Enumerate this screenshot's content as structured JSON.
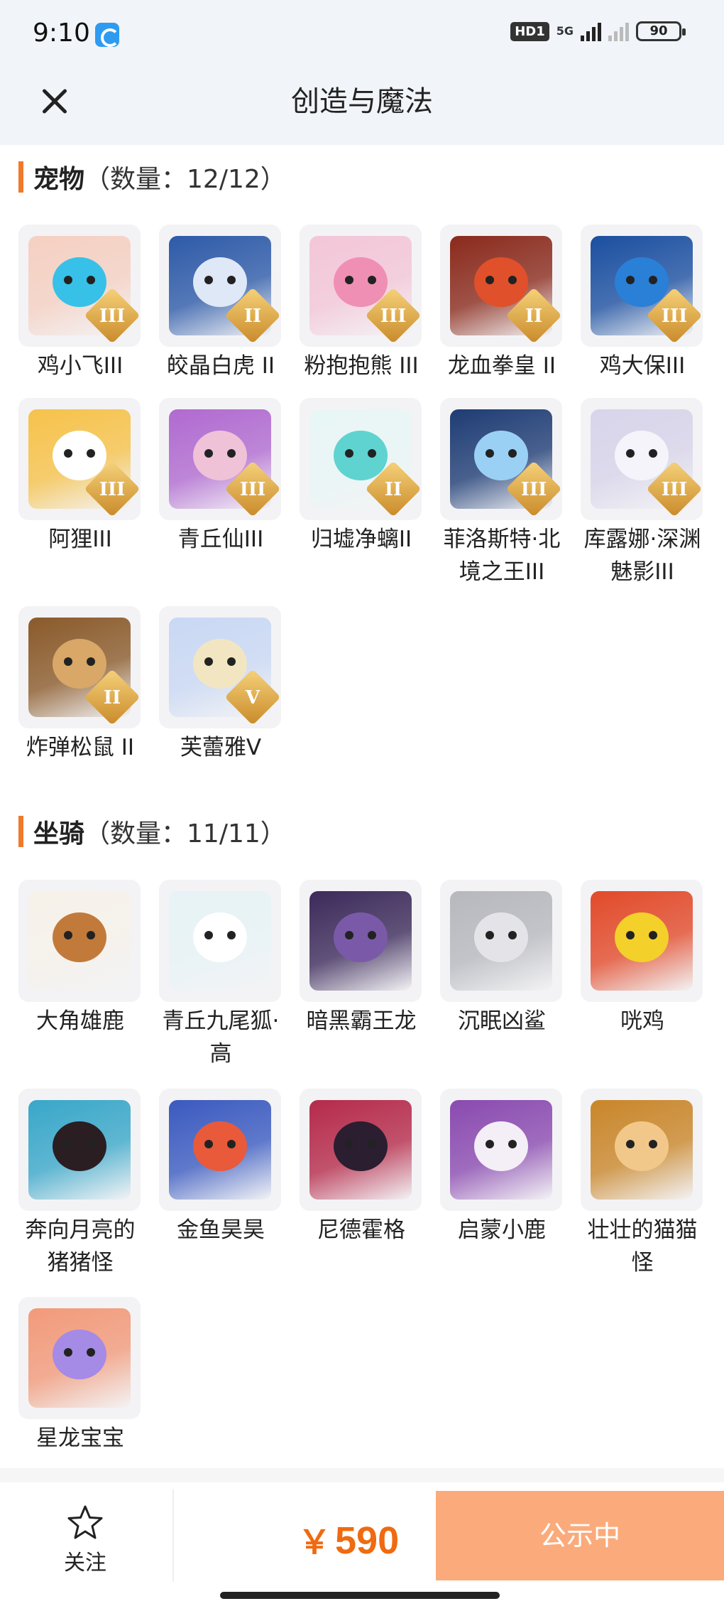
{
  "status_bar": {
    "time": "9:10",
    "network_badge": "HD1",
    "network_type": "5G",
    "battery": "90"
  },
  "header": {
    "title": "创造与魔法"
  },
  "pets": {
    "title": "宠物",
    "count": "（数量：12/12）",
    "items": [
      {
        "label": "鸡小飞III",
        "rank": "III",
        "color": "#37c1e8",
        "bg": "#f5d0c2"
      },
      {
        "label": "皎晶白虎 II",
        "rank": "II",
        "color": "#dfe8f7",
        "bg": "#2d5aa8"
      },
      {
        "label": "粉抱抱熊 III",
        "rank": "III",
        "color": "#f08fb4",
        "bg": "#f3c6d8"
      },
      {
        "label": "龙血拳皇 II",
        "rank": "II",
        "color": "#e0502a",
        "bg": "#8a2a1c"
      },
      {
        "label": "鸡大保III",
        "rank": "III",
        "color": "#2a7fd6",
        "bg": "#1b4fa0"
      },
      {
        "label": "阿狸III",
        "rank": "III",
        "color": "#ffffff",
        "bg": "#f6c24a"
      },
      {
        "label": "青丘仙III",
        "rank": "III",
        "color": "#f0c2d8",
        "bg": "#b06ad0"
      },
      {
        "label": "归墟净螭II",
        "rank": "II",
        "color": "#5fd3d0",
        "bg": "#e8f6f5"
      },
      {
        "label": "菲洛斯特·北境之王III",
        "rank": "III",
        "color": "#9ad0f4",
        "bg": "#1e3c74"
      },
      {
        "label": "库露娜·深渊魅影III",
        "rank": "III",
        "color": "#f4f4fa",
        "bg": "#d8d4ea"
      },
      {
        "label": "炸弹松鼠 II",
        "rank": "II",
        "color": "#d9a768",
        "bg": "#8a5a2a"
      },
      {
        "label": "芙蕾雅V",
        "rank": "V",
        "color": "#f2e6c2",
        "bg": "#c9d8f4"
      }
    ]
  },
  "mounts": {
    "title": "坐骑",
    "count": "（数量：11/11）",
    "items": [
      {
        "label": "大角雄鹿",
        "color": "#c27a3a",
        "bg": "#f6f2ea"
      },
      {
        "label": "青丘九尾狐·高",
        "color": "#ffffff",
        "bg": "#e7f3f6"
      },
      {
        "label": "暗黑霸王龙",
        "color": "#7a5aa8",
        "bg": "#3c2a5a"
      },
      {
        "label": "沉眠凶鲨",
        "color": "#e4e4e8",
        "bg": "#b7b8be"
      },
      {
        "label": "咣鸡",
        "color": "#f4d02a",
        "bg": "#e24a2a"
      },
      {
        "label": "奔向月亮的猪猪怪",
        "color": "#2a1e22",
        "bg": "#39a7c9"
      },
      {
        "label": "金鱼昊昊",
        "color": "#e85a3a",
        "bg": "#3a5ac0"
      },
      {
        "label": "尼德霍格",
        "color": "#2a1e30",
        "bg": "#b52a4a"
      },
      {
        "label": "启蒙小鹿",
        "color": "#f4eef6",
        "bg": "#8a4ab0"
      },
      {
        "label": "壮壮的猫猫怪",
        "color": "#f2c88a",
        "bg": "#c9862a"
      },
      {
        "label": "星龙宝宝",
        "color": "#a58ae6",
        "bg": "#f29a7a"
      }
    ]
  },
  "bottom": {
    "follow_label": "关注",
    "currency": "￥",
    "price": "590",
    "status_label": "公示中"
  }
}
